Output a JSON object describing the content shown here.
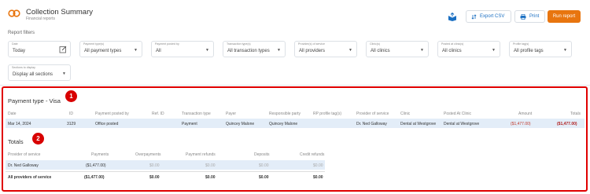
{
  "header": {
    "title": "Collection Summary",
    "subtitle": "Financial reports",
    "export_label": "Export CSV",
    "print_label": "Print",
    "run_label": "Run report"
  },
  "filters": {
    "section_label": "Report filters",
    "date": {
      "label": "Date",
      "value": "Today"
    },
    "payment_types": {
      "label": "Payment type(s)",
      "value": "All payment types"
    },
    "payment_posted_by": {
      "label": "Payment posted by",
      "value": "All"
    },
    "transaction_types": {
      "label": "Transaction type(s)",
      "value": "All transaction types"
    },
    "providers": {
      "label": "Provider(s) of service",
      "value": "All providers"
    },
    "clinics": {
      "label": "Clinic(s)",
      "value": "All clinics"
    },
    "posted_at_clinics": {
      "label": "Posted at clinic(s)",
      "value": "All clinics"
    },
    "profile_tags": {
      "label": "Profile tag(s)",
      "value": "All profile tags"
    },
    "sections": {
      "label": "Sections to display",
      "value": "Display all sections"
    }
  },
  "payment_section": {
    "badge": "1",
    "title": "Payment type - Visa",
    "columns": [
      "Date",
      "ID",
      "Payment posted by",
      "Ref. ID",
      "Transaction type",
      "Payer",
      "Responsible party",
      "RP profile tag(s)",
      "Provider of service",
      "Clinic",
      "Posted At Clinic",
      "Amount",
      "Totals"
    ],
    "row": {
      "date": "Mar 14, 2024",
      "id": "3129",
      "posted_by": "Office posted",
      "ref_id": "",
      "transaction_type": "Payment",
      "payer": "Quincey Malone",
      "responsible_party": "Quincey Malone",
      "rp_tags": "",
      "provider": "Dr. Ned Galloway",
      "clinic": "Dental at Westgrove",
      "posted_at_clinic": "Dental at Westgrove",
      "amount": "($1,477.00)",
      "total": "($1,477.00)"
    }
  },
  "totals_section": {
    "badge": "2",
    "title": "Totals",
    "columns": [
      "Provider of service",
      "Payments",
      "Overpayments",
      "Payment refunds",
      "Deposits",
      "Credit refunds"
    ],
    "row": {
      "provider": "Dr. Ned Galloway",
      "payments": "($1,477.00)",
      "overpayments": "$0.00",
      "payment_refunds": "$0.00",
      "deposits": "$0.00",
      "credit_refunds": "$0.00"
    },
    "footer": {
      "provider": "All providers of service",
      "payments": "($1,477.00)",
      "overpayments": "$0.00",
      "payment_refunds": "$0.00",
      "deposits": "$0.00",
      "credit_refunds": "$0.00"
    }
  },
  "colors": {
    "accent": "#e8750f",
    "link": "#1a6fc2",
    "highlight": "#e00000",
    "row_bg": "#e3edf8"
  }
}
